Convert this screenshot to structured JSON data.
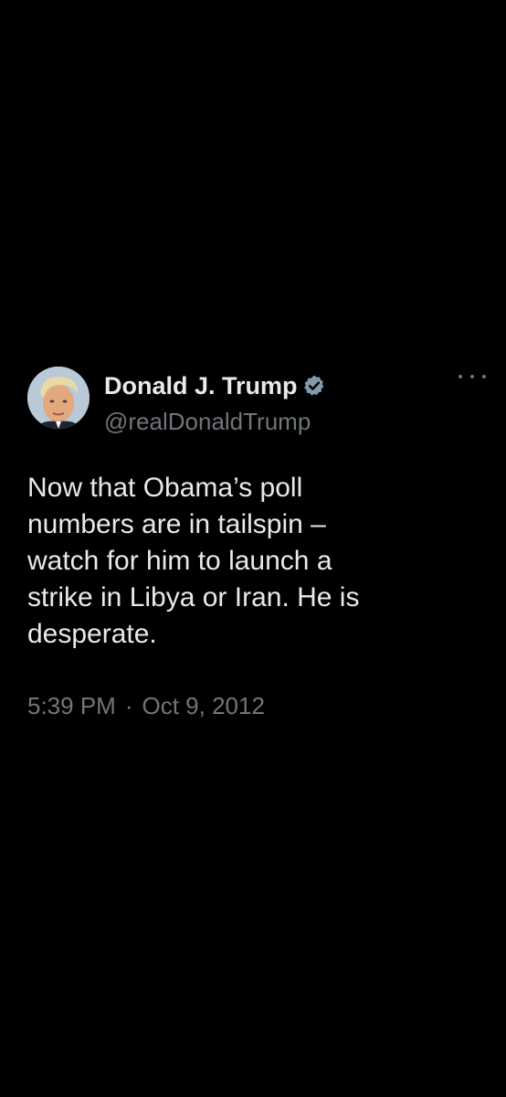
{
  "tweet": {
    "author": {
      "display_name": "Donald J. Trump",
      "handle": "@realDonaldTrump",
      "verified": true,
      "verified_badge_color": "#829aab",
      "avatar_icon": "profile-photo"
    },
    "more_icon": "more-horizontal-icon",
    "text": "Now that Obama’s poll\nnumbers are in tailspin –\nwatch for him to launch a\nstrike in Libya or Iran.  He is\ndesperate.",
    "time": "5:39 PM",
    "separator": "·",
    "date": "Oct 9, 2012"
  },
  "colors": {
    "background": "#000000",
    "primary_text": "#e7e9ea",
    "secondary_text": "#71767b"
  }
}
